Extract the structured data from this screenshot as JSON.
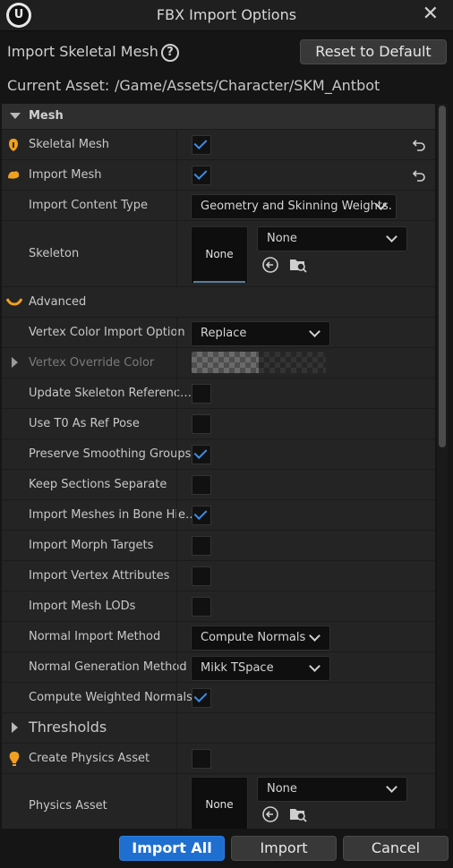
{
  "window": {
    "title": "FBX Import Options",
    "logo_text": "U"
  },
  "header": {
    "label": "Import Skeletal Mesh",
    "help_glyph": "?",
    "reset_label": "Reset to Default"
  },
  "current_asset": {
    "label": "Current Asset:",
    "value": "/Game/Assets/Character/SKM_Antbot"
  },
  "mesh_section": {
    "label": "Mesh"
  },
  "rows": {
    "skeletal_mesh": "Skeletal Mesh",
    "import_mesh": "Import Mesh",
    "import_content_type": "Import Content Type",
    "import_content_type_value": "Geometry and Skinning Weights.",
    "skeleton": "Skeleton",
    "skeleton_thumb": "None",
    "skeleton_value": "None",
    "advanced": "Advanced",
    "vertex_color_import_option": "Vertex Color Import Option",
    "vertex_color_import_option_value": "Replace",
    "vertex_override_color": "Vertex Override Color",
    "update_skeleton_reference": "Update Skeleton Referenc…",
    "use_t0_as_ref_pose": "Use T0 As Ref Pose",
    "preserve_smoothing_groups": "Preserve Smoothing Groups",
    "keep_sections_separate": "Keep Sections Separate",
    "import_meshes_in_bone_hierarchy": "Import Meshes in Bone Hie…",
    "import_morph_targets": "Import Morph Targets",
    "import_vertex_attributes": "Import Vertex Attributes",
    "import_mesh_lods": "Import Mesh LODs",
    "normal_import_method": "Normal Import Method",
    "normal_import_method_value": "Compute Normals",
    "normal_generation_method": "Normal Generation Method",
    "normal_generation_method_value": "Mikk TSpace",
    "compute_weighted_normals": "Compute Weighted Normals",
    "thresholds": "Thresholds",
    "create_physics_asset": "Create Physics Asset",
    "physics_asset": "Physics Asset",
    "physics_thumb": "None",
    "physics_value": "None"
  },
  "checkboxes": {
    "skeletal_mesh": true,
    "import_mesh": true,
    "update_skeleton_reference": false,
    "use_t0_as_ref_pose": false,
    "preserve_smoothing_groups": true,
    "keep_sections_separate": false,
    "import_meshes_in_bone_hierarchy": true,
    "import_morph_targets": false,
    "import_vertex_attributes": false,
    "import_mesh_lods": false,
    "compute_weighted_normals": true,
    "create_physics_asset": false
  },
  "footer": {
    "import_all": "Import All",
    "import": "Import",
    "cancel": "Cancel"
  },
  "colors": {
    "accent": "#1f6fd0",
    "check": "#3d8ee8",
    "orange": "#f0a020"
  }
}
